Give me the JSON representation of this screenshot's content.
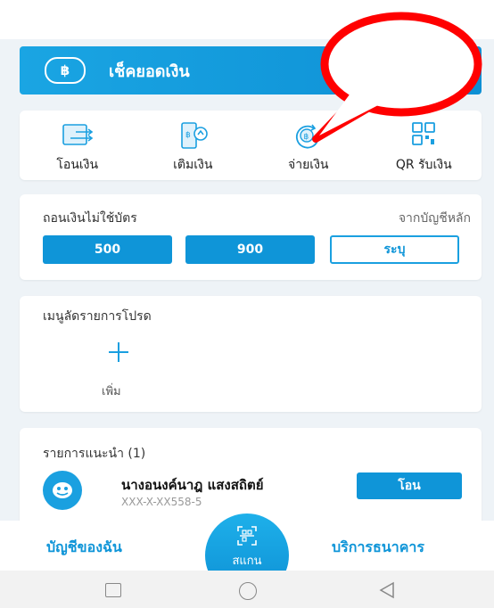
{
  "balance_bar": {
    "label": "เช็คยอดเงิน",
    "icon": "baht-icon",
    "icon_text": "฿"
  },
  "quick_actions": [
    {
      "label": "โอนเงิน",
      "icon": "transfer-icon"
    },
    {
      "label": "เติมเงิน",
      "icon": "topup-icon"
    },
    {
      "label": "จ่ายเงิน",
      "icon": "pay-icon"
    },
    {
      "label": "QR รับเงิน",
      "icon": "qr-icon"
    }
  ],
  "withdraw": {
    "title": "ถอนเงินไม่ใช้บัตร",
    "source": "จากบัญชีหลัก",
    "amounts": [
      "500",
      "900"
    ],
    "custom_label": "ระบุ"
  },
  "favorites": {
    "title": "เมนูลัดรายการโปรด",
    "add_label": "เพิ่ม"
  },
  "recommend": {
    "title": "รายการแนะนำ (1)",
    "items": [
      {
        "name": "นางอนงค์นาฎ แสงสถิตย์",
        "account": "XXX-X-XX558-5",
        "action_label": "โอน"
      }
    ]
  },
  "bottom_nav": {
    "left_label": "บัญชีของฉัน",
    "scan_label": "สแกน",
    "right_label": "บริการธนาคาร"
  },
  "colors": {
    "primary": "#0f95d8",
    "accent_gradient_start": "#1aa5e3",
    "annotation": "#ff0000"
  }
}
